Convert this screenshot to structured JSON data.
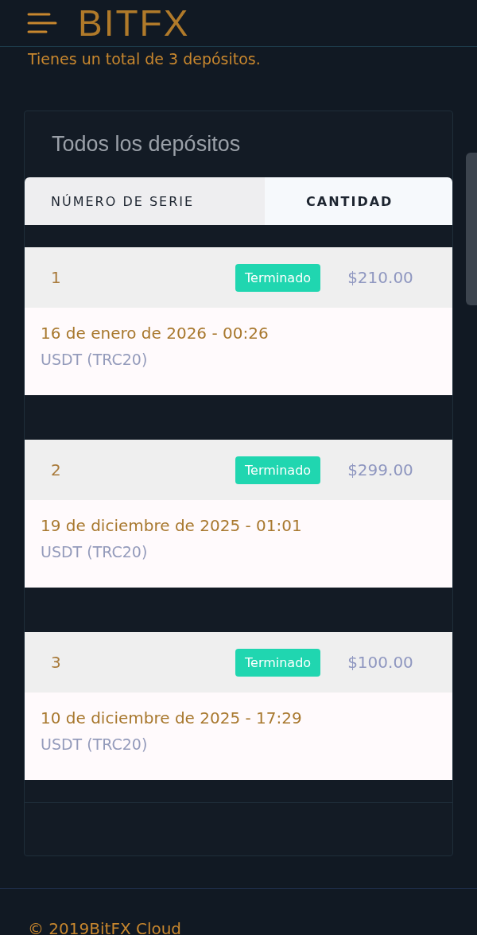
{
  "header": {
    "logo": "BITFX"
  },
  "intro": "Tienes un total de 3 depósitos.",
  "card": {
    "title": "Todos los depósitos",
    "columns": [
      {
        "label": "NÚMERO DE SERIE",
        "selected": false
      },
      {
        "label": "CANTIDAD",
        "selected": true
      }
    ],
    "rows": [
      {
        "serial": "1",
        "status": "Terminado",
        "amount": "$210.00",
        "date": "16 de enero de 2026 - 00:26",
        "method": "USDT (TRC20)"
      },
      {
        "serial": "2",
        "status": "Terminado",
        "amount": "$299.00",
        "date": "19 de diciembre de 2025 - 01:01",
        "method": "USDT (TRC20)"
      },
      {
        "serial": "3",
        "status": "Terminado",
        "amount": "$100.00",
        "date": "10 de diciembre de 2025 - 17:29",
        "method": "USDT (TRC20)"
      }
    ]
  },
  "footer": "© 2019BitFX Cloud"
}
